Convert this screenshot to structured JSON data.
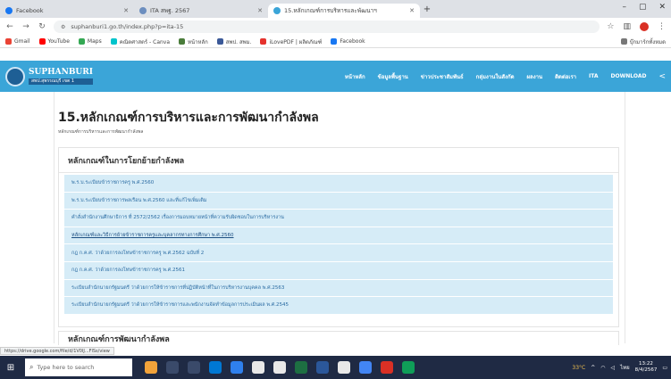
{
  "browser": {
    "tabs": [
      {
        "label": "Facebook",
        "color": "#1877f2",
        "active": false
      },
      {
        "label": "ITA สพฐ. 2567",
        "color": "#6c8ebf",
        "active": false
      },
      {
        "label": "15.หลักเกณฑ์การบริหารและพัฒนาฯ",
        "color": "#3ba5d8",
        "active": true
      }
    ],
    "url": "suphanburi1.go.th/index.php?p=ita-15",
    "bookmarks": [
      "Gmail",
      "YouTube",
      "Maps",
      "คณิตศาสตร์ - Canva",
      "หน้าหลัก",
      "สพป. สพม.",
      "iLovePDF | ผลิตภัณฑ์",
      "Facebook"
    ],
    "bookmarks_right": "บุ๊กมาร์กทั้งหมด"
  },
  "site": {
    "logo_name": "SUPHANBURI",
    "logo_sub": "สพป.สุพรรณบุรี เขต 1",
    "nav": [
      "หน้าหลัก",
      "ข้อมูลพื้นฐาน",
      "ข่าวประชาสัมพันธ์",
      "กลุ่มงานในสังกัด",
      "ผลงาน",
      "ติดต่อเรา",
      "ITA",
      "DOWNLOAD"
    ]
  },
  "page": {
    "title": "15.หลักเกณฑ์การบริหารและการพัฒนากำลังพล",
    "breadcrumb": "หลักเกณฑ์การบริหารและการพัฒนากำลังพล",
    "section1_title": "หลักเกณฑ์ในการโยกย้ายกำลังพล",
    "items": [
      "พ.ร.บ.ระเบียบข้าราชการครู พ.ศ.2560",
      "พ.ร.บ.ระเบียบข้าราชการพลเรือน พ.ศ.2560 และที่แก้ไขเพิ่มเติม",
      "คำสั่งสำนักงานศึกษาธิการ ที่ 2572/2562 เรื่องการมอบหมายหน้าที่ความรับผิดชอบในการบริหารงาน",
      "หลักเกณฑ์และวิธีการย้ายข้าราชการครูและบุคลากรทางการศึกษา พ.ศ.2560",
      "กฎ ก.ค.ศ. ว่าด้วยการลงโทษข้าราชการครู พ.ศ.2562 ฉบับที่ 2",
      "กฎ ก.ค.ศ. ว่าด้วยการลงโทษข้าราชการครู พ.ศ.2561",
      "ระเบียบสำนักนายกรัฐมนตรี ว่าด้วยการให้ข้าราชการที่ปฏิบัติหน้าที่ในการบริหารงานบุคคล พ.ศ.2563",
      "ระเบียบสำนักนายกรัฐมนตรี ว่าด้วยการให้ข้าราชการและพนักงานจัดทำข้อมูลการประเมินผล พ.ศ.2545"
    ],
    "underlined_index": 3,
    "section2_title": "หลักเกณฑ์การพัฒนากำลังพล"
  },
  "status_url": "https://drive.google.com/file/d/1V0lJ...FlSs/view",
  "taskbar": {
    "search_placeholder": "Type here to search",
    "weather": "33°C",
    "lang": "ไทย",
    "time": "13:22",
    "date": "8/4/2567"
  },
  "colors": {
    "header": "#3ba5d8",
    "list_bg": "#d6ecf7",
    "link": "#2b6ca3"
  }
}
